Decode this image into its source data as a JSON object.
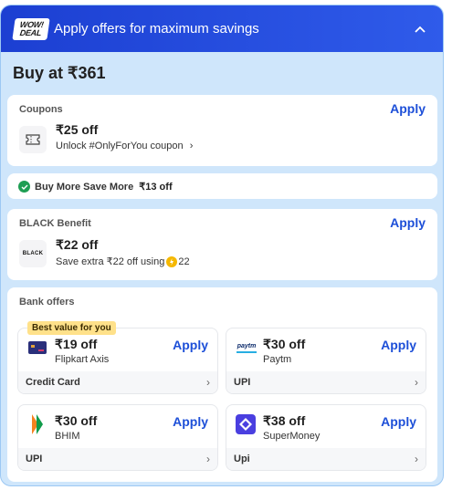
{
  "header": {
    "badge_line1": "WOW!",
    "badge_line2": "DEAL",
    "title": "Apply offers for maximum savings"
  },
  "buy_at": "Buy at ₹361",
  "coupons": {
    "label": "Coupons",
    "apply_label": "Apply",
    "amount": "₹25 off",
    "subtitle": "Unlock #OnlyForYou coupon"
  },
  "bmsm": {
    "label": "Buy More Save More",
    "amount": "₹13 off"
  },
  "black": {
    "label": "BLACK Benefit",
    "apply_label": "Apply",
    "logo_text": "BLACK",
    "amount": "₹22 off",
    "subtitle": "Save extra ₹22 off using",
    "coins": "22"
  },
  "bank": {
    "label": "Bank offers",
    "best_badge": "Best value for you",
    "tiles": [
      {
        "amount": "₹19 off",
        "name": "Flipkart Axis",
        "apply_label": "Apply",
        "footer": "Credit Card"
      },
      {
        "amount": "₹30 off",
        "name": "Paytm",
        "apply_label": "Apply",
        "footer": "UPI",
        "logo_text": "paytm"
      },
      {
        "amount": "₹30 off",
        "name": "BHIM",
        "apply_label": "Apply",
        "footer": "UPI"
      },
      {
        "amount": "₹38 off",
        "name": "SuperMoney",
        "apply_label": "Apply",
        "footer": "Upi"
      }
    ]
  }
}
